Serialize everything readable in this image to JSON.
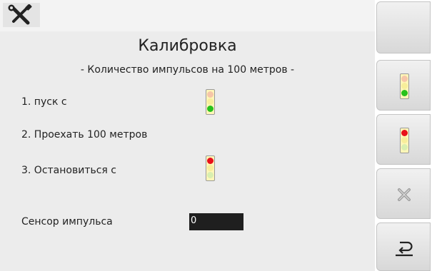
{
  "window": {
    "title": "Калибровка",
    "subtitle": "- Количество импульсов на 100 метров -"
  },
  "steps": [
    {
      "label": "1. пуск с",
      "signal": "green"
    },
    {
      "label": "2. Проехать 100 метров"
    },
    {
      "label": "3. Остановиться с",
      "signal": "red"
    }
  ],
  "sensor": {
    "label": "Сенсор импульса",
    "value": "0"
  },
  "icons": {
    "top_left": "tools-icon",
    "side_button_2": "traffic-light-green-icon",
    "side_button_3": "traffic-light-red-icon",
    "side_button_4": "close-icon",
    "side_button_5": "back-icon"
  },
  "colors": {
    "panel_bg": "#ececec",
    "side_button_bg": "#e4e4e4",
    "signal_green": "#27c21b",
    "signal_red": "#e8101a",
    "input_bg": "#1f1f1f"
  }
}
